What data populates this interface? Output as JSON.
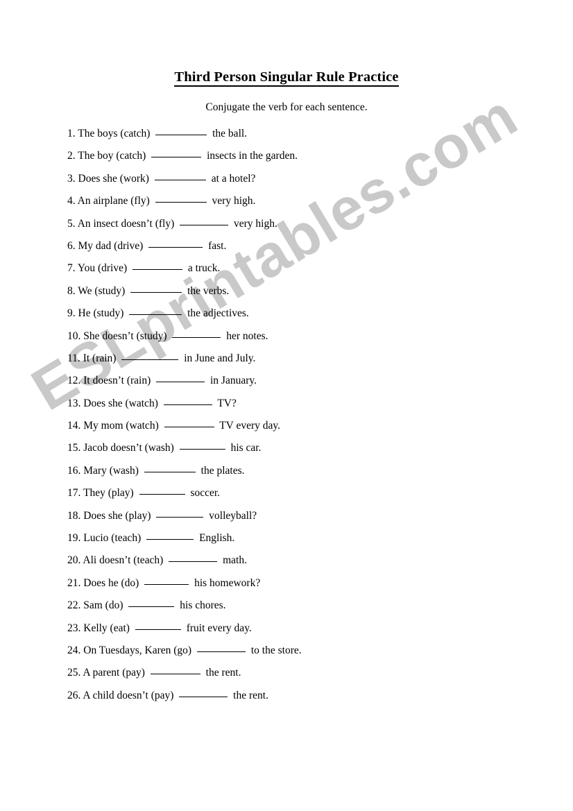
{
  "document": {
    "title": "Third Person Singular Rule Practice",
    "subtitle": "Conjugate the verb for each sentence."
  },
  "watermark": {
    "text": "ESLprintables.com",
    "color": "#c9c9c9",
    "rotation_deg": -31
  },
  "colors": {
    "page_background": "#ffffff",
    "text": "#000000",
    "rule": "#000000",
    "watermark": "#c9c9c9"
  },
  "questions": [
    {
      "number": "1.",
      "before": "The boys (catch)",
      "blank_width": 74,
      "after": "the ball."
    },
    {
      "number": "2.",
      "before": "The boy (catch)",
      "blank_width": 72,
      "after": "insects in the garden."
    },
    {
      "number": "3.",
      "before": "Does she (work)",
      "blank_width": 74,
      "after": "at a hotel?"
    },
    {
      "number": "4.",
      "before": "An airplane (fly)",
      "blank_width": 74,
      "after": "very high."
    },
    {
      "number": "5.",
      "before": "An insect doesn’t (fly)",
      "blank_width": 70,
      "after": "very high."
    },
    {
      "number": "6.",
      "before": "My dad (drive)",
      "blank_width": 78,
      "after": "fast."
    },
    {
      "number": "7.",
      "before": "You (drive)",
      "blank_width": 72,
      "after": "a truck."
    },
    {
      "number": "8.",
      "before": "We (study)",
      "blank_width": 74,
      "after": "the verbs."
    },
    {
      "number": "9.",
      "before": "He (study)",
      "blank_width": 76,
      "after": "the adjectives."
    },
    {
      "number": "10.",
      "before": "She doesn’t (study)",
      "blank_width": 70,
      "after": "her notes."
    },
    {
      "number": "11.",
      "before": "It (rain)",
      "blank_width": 82,
      "after": "in June and July."
    },
    {
      "number": "12.",
      "before": "It doesn’t (rain)",
      "blank_width": 70,
      "after": "in January."
    },
    {
      "number": "13.",
      "before": "Does she (watch)",
      "blank_width": 70,
      "after": "TV?"
    },
    {
      "number": "14.",
      "before": "My mom (watch)",
      "blank_width": 72,
      "after": "TV every day."
    },
    {
      "number": "15.",
      "before": "Jacob doesn’t (wash)",
      "blank_width": 66,
      "after": "his car."
    },
    {
      "number": "16.",
      "before": "Mary (wash)",
      "blank_width": 74,
      "after": "the plates."
    },
    {
      "number": "17.",
      "before": "They (play)",
      "blank_width": 66,
      "after": "soccer."
    },
    {
      "number": "18.",
      "before": "Does she (play)",
      "blank_width": 68,
      "after": "volleyball?"
    },
    {
      "number": "19.",
      "before": "Lucio (teach)",
      "blank_width": 68,
      "after": "English."
    },
    {
      "number": "20.",
      "before": "Ali doesn’t (teach)",
      "blank_width": 70,
      "after": "math."
    },
    {
      "number": "21.",
      "before": "Does he (do)",
      "blank_width": 64,
      "after": "his homework?"
    },
    {
      "number": "22.",
      "before": "Sam (do)",
      "blank_width": 66,
      "after": "his chores."
    },
    {
      "number": "23.",
      "before": "Kelly (eat)",
      "blank_width": 66,
      "after": "fruit every day."
    },
    {
      "number": "24.",
      "before": "On Tuesdays, Karen (go)",
      "blank_width": 70,
      "after": "to the store."
    },
    {
      "number": "25.",
      "before": "A parent (pay)",
      "blank_width": 72,
      "after": "the rent."
    },
    {
      "number": "26.",
      "before": "A child doesn’t (pay)",
      "blank_width": 70,
      "after": "the rent."
    }
  ]
}
